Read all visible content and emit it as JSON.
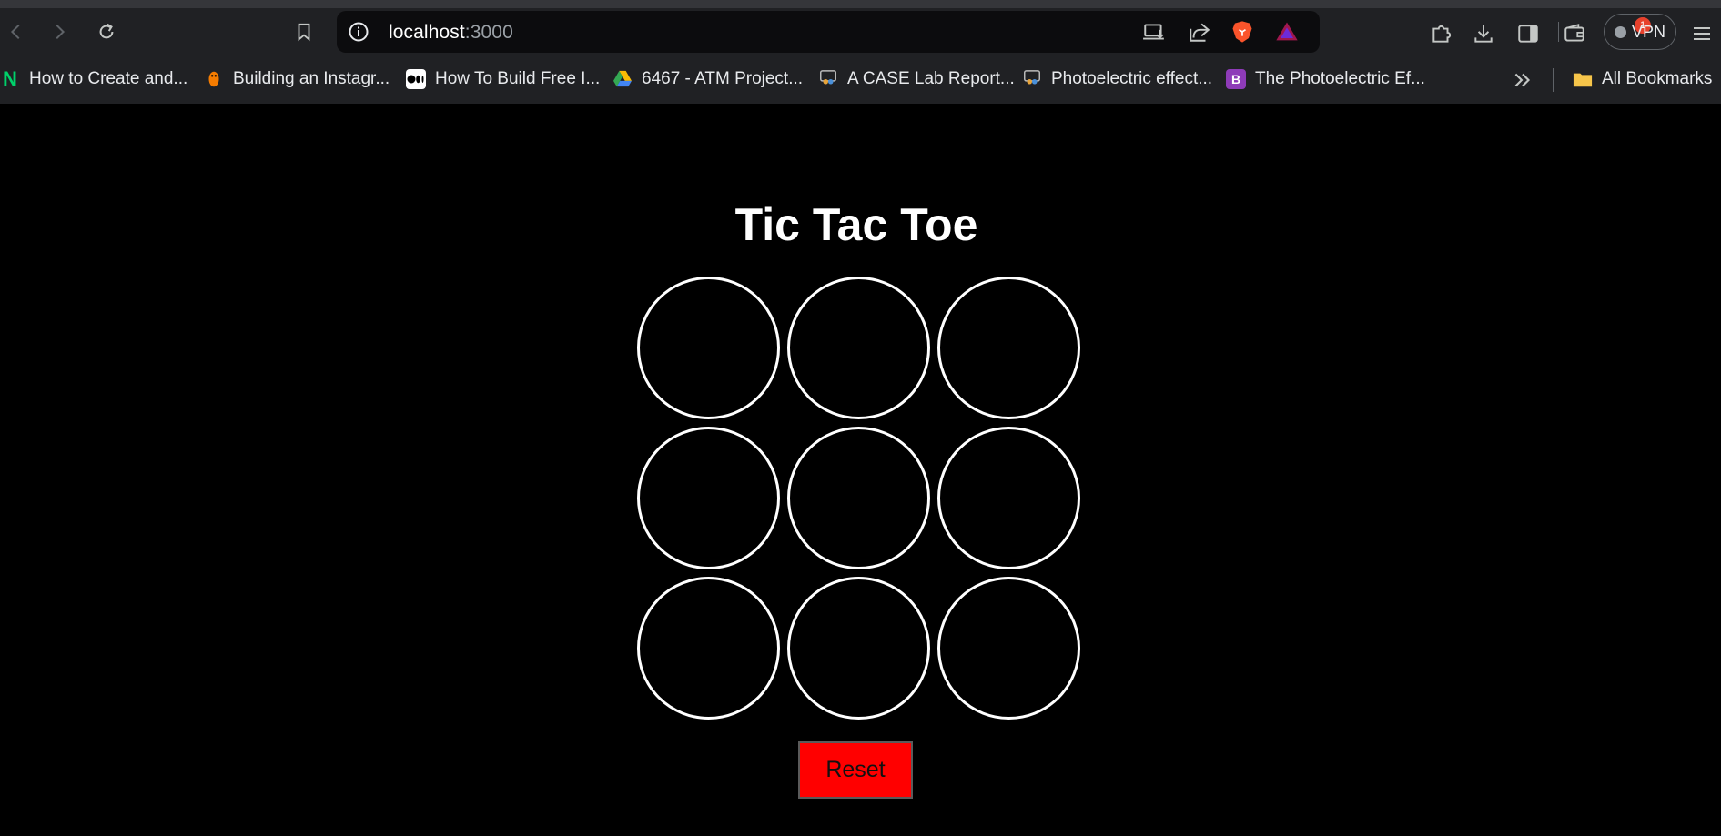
{
  "browser": {
    "url_host": "localhost",
    "url_port": ":3000",
    "notification_count": "1",
    "vpn_label": "VPN",
    "bookmarks": [
      {
        "label": "How to Create and...",
        "icon": "n-logo-icon",
        "color": "#00d16a"
      },
      {
        "label": "Building an Instagr...",
        "icon": "penguin-icon",
        "color": "#f57c00"
      },
      {
        "label": "How To Build Free I...",
        "icon": "medium-icon",
        "color": "#ffffff"
      },
      {
        "label": "6467 - ATM Project...",
        "icon": "google-drive-icon",
        "color": "#34a853"
      },
      {
        "label": "A CASE Lab Report...",
        "icon": "slideshare-icon",
        "color": "#4a90d9"
      },
      {
        "label": "Photoelectric effect...",
        "icon": "slideshare-icon",
        "color": "#4a90d9"
      },
      {
        "label": "The Photoelectric Ef...",
        "icon": "b-logo-icon",
        "color": "#8e3bb8"
      }
    ],
    "all_bookmarks_label": "All Bookmarks"
  },
  "game": {
    "title": "Tic Tac Toe",
    "cells": [
      "",
      "",
      "",
      "",
      "",
      "",
      "",
      "",
      ""
    ],
    "reset_label": "Reset"
  },
  "colors": {
    "page_background": "#000000",
    "cell_border": "#ffffff",
    "reset_background": "#ff0000"
  }
}
